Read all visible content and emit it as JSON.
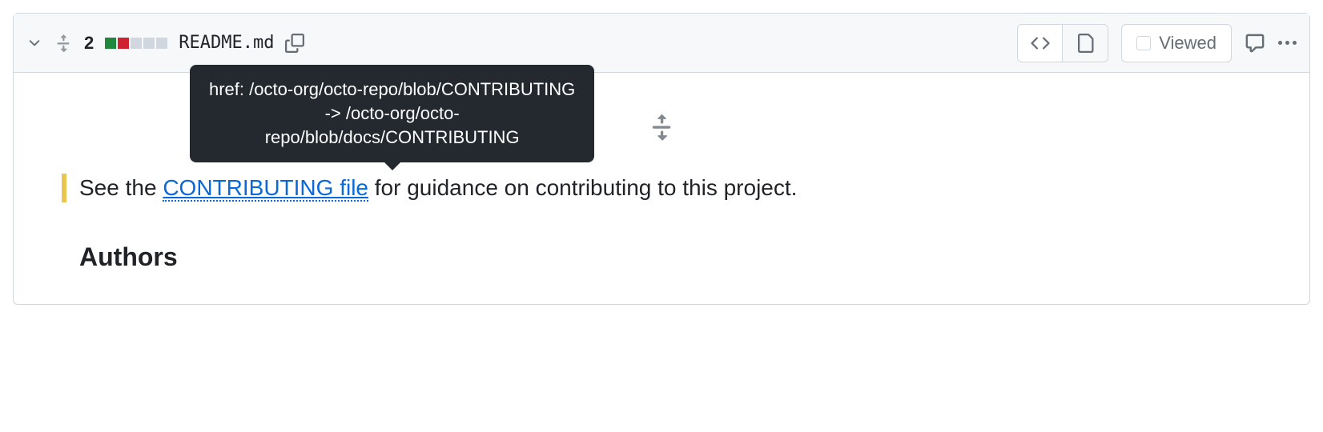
{
  "header": {
    "line_count": "2",
    "filename": "README.md",
    "viewed_label": "Viewed"
  },
  "content": {
    "prefix_text": "See the ",
    "link_text": "CONTRIBUTING file",
    "suffix_text": " for guidance on contributing to this project.",
    "heading": "Authors"
  },
  "tooltip": {
    "line1": "href: /octo-org/octo-repo/blob/CONTRIBUTING",
    "line2": "-> /octo-org/octo-",
    "line3": "repo/blob/docs/CONTRIBUTING"
  }
}
